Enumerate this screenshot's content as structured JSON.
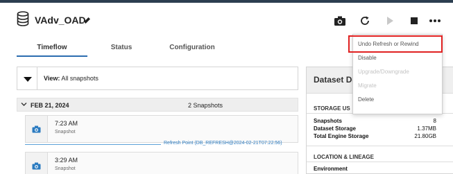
{
  "app": {
    "title": "VAdv_OAD"
  },
  "toolbar": {
    "icons": [
      "database-icon",
      "pencil-icon",
      "camera-icon",
      "refresh-icon",
      "play-icon",
      "stop-icon",
      "more-icon"
    ]
  },
  "tabs": [
    {
      "label": "Timeflow",
      "active": true
    },
    {
      "label": "Status",
      "active": false
    },
    {
      "label": "Configuration",
      "active": false
    }
  ],
  "view": {
    "prefix": "View:",
    "value": "All snapshots"
  },
  "timeline": {
    "date": "FEB 21, 2024",
    "snapshot_count": "2 Snapshots",
    "snapshots": [
      {
        "time": "7:23 AM",
        "type": "Snapshot"
      },
      {
        "time": "3:29 AM",
        "type": "Snapshot"
      }
    ],
    "refresh_point": "Refresh Point (DB_REFRESH@2024-02-21T07:22:56)"
  },
  "dataset_details": {
    "title": "Dataset De",
    "storage_section": "STORAGE US",
    "rows": [
      {
        "key": "Snapshots",
        "value": "8"
      },
      {
        "key": "Dataset Storage",
        "value": "1.37MB"
      },
      {
        "key": "Total Engine Storage",
        "value": "21.80GB"
      }
    ],
    "lineage_section": "LOCATION & LINEAGE",
    "environment_label": "Environment"
  },
  "menu": {
    "items": [
      {
        "label": "Undo Refresh or Rewind",
        "enabled": true
      },
      {
        "label": "Disable",
        "enabled": true
      },
      {
        "label": "Upgrade/Downgrade",
        "enabled": false
      },
      {
        "label": "Migrate",
        "enabled": false
      },
      {
        "label": "Delete",
        "enabled": true
      }
    ]
  },
  "colors": {
    "accent": "#2b6cb0",
    "highlight": "#e02020",
    "camera": "#2b7bc0"
  }
}
